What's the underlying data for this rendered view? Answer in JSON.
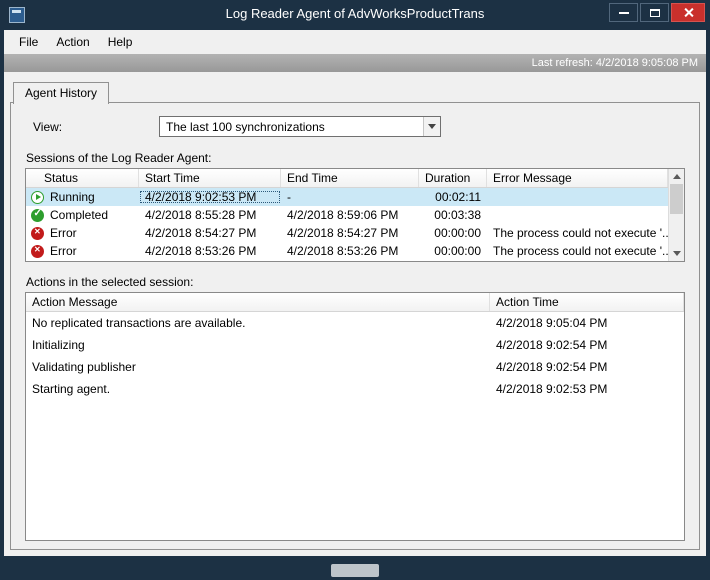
{
  "window": {
    "title": "Log Reader Agent of AdvWorksProductTrans"
  },
  "statusbar": {
    "last_refresh": "Last refresh: 4/2/2018 9:05:08 PM"
  },
  "menu": {
    "items": [
      {
        "label": "File"
      },
      {
        "label": "Action"
      },
      {
        "label": "Help"
      }
    ]
  },
  "tab": {
    "label": "Agent History"
  },
  "view": {
    "label": "View:",
    "value": "The last 100 synchronizations"
  },
  "sessions": {
    "label": "Sessions of the Log Reader Agent:",
    "columns": [
      "Status",
      "Start Time",
      "End Time",
      "Duration",
      "Error Message"
    ],
    "rows": [
      {
        "status": "Running",
        "start": "4/2/2018 9:02:53 PM",
        "end": "-",
        "duration": "00:02:11",
        "error": ""
      },
      {
        "status": "Completed",
        "start": "4/2/2018 8:55:28 PM",
        "end": "4/2/2018 8:59:06 PM",
        "duration": "00:03:38",
        "error": ""
      },
      {
        "status": "Error",
        "start": "4/2/2018 8:54:27 PM",
        "end": "4/2/2018 8:54:27 PM",
        "duration": "00:00:00",
        "error": "The process could not execute '..."
      },
      {
        "status": "Error",
        "start": "4/2/2018 8:53:26 PM",
        "end": "4/2/2018 8:53:26 PM",
        "duration": "00:00:00",
        "error": "The process could not execute '..."
      }
    ]
  },
  "actions": {
    "label": "Actions in the selected session:",
    "columns": [
      "Action Message",
      "Action Time"
    ],
    "rows": [
      {
        "message": "No replicated transactions are available.",
        "time": "4/2/2018 9:05:04 PM"
      },
      {
        "message": "Initializing",
        "time": "4/2/2018 9:02:54 PM"
      },
      {
        "message": "Validating publisher",
        "time": "4/2/2018 9:02:54 PM"
      },
      {
        "message": "Starting agent.",
        "time": "4/2/2018 9:02:53 PM"
      }
    ]
  },
  "colors": {
    "titlebar": "#1c3144",
    "close_button": "#c9302c",
    "selection": "#cbe8f6",
    "status_green": "#2e9e2e",
    "status_red": "#c21b1b"
  }
}
